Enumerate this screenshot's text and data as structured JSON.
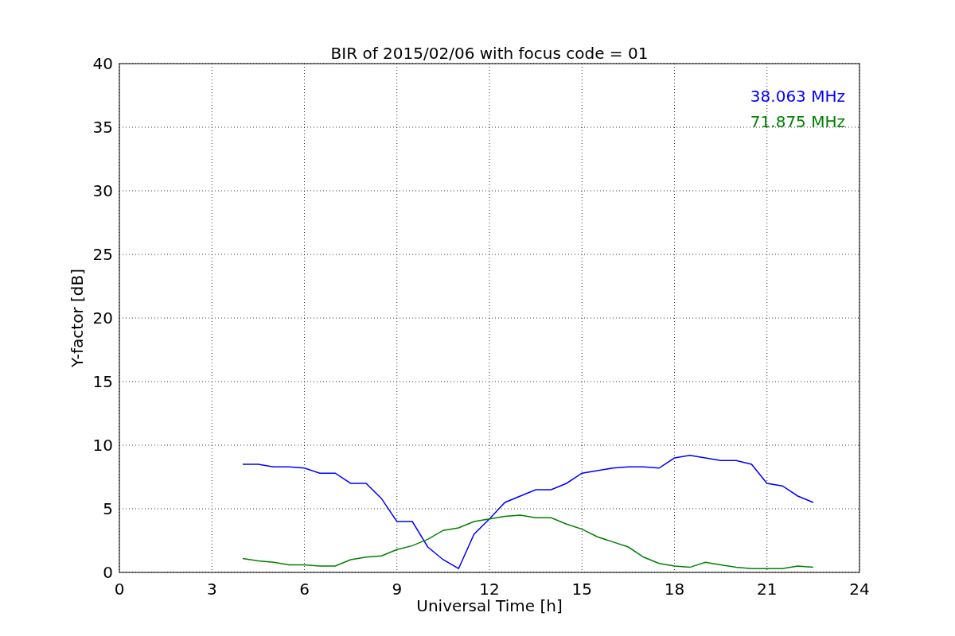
{
  "chart_data": {
    "type": "line",
    "title": "BIR of 2015/02/06 with focus code = 01",
    "xlabel": "Universal Time [h]",
    "ylabel": "Y-factor [dB]",
    "x": [
      4,
      4.5,
      5,
      5.5,
      6,
      6.5,
      7,
      7.5,
      8,
      8.5,
      9,
      9.5,
      10,
      10.5,
      11,
      11.5,
      12,
      12.5,
      13,
      13.5,
      14,
      14.5,
      15,
      15.5,
      16,
      16.5,
      17,
      17.5,
      18,
      18.5,
      19,
      19.5,
      20,
      20.5,
      21,
      21.5,
      22,
      22.5
    ],
    "series": [
      {
        "name": "38.063 MHz",
        "color": "#0000ff",
        "values": [
          8.5,
          8.5,
          8.3,
          8.3,
          8.2,
          7.8,
          7.8,
          7,
          7,
          5.8,
          4,
          4,
          2,
          1,
          0.3,
          3,
          4.2,
          5.5,
          6,
          6.5,
          6.5,
          7,
          7.8,
          8,
          8.2,
          8.3,
          8.3,
          8.2,
          9,
          9.2,
          9,
          8.8,
          8.8,
          8.5,
          7,
          6.8,
          6,
          5.5
        ]
      },
      {
        "name": "71.875 MHz",
        "color": "#008000",
        "values": [
          1.1,
          0.9,
          0.8,
          0.6,
          0.6,
          0.5,
          0.5,
          1,
          1.2,
          1.3,
          1.8,
          2.1,
          2.6,
          3.3,
          3.5,
          4,
          4.2,
          4.4,
          4.5,
          4.3,
          4.3,
          3.8,
          3.4,
          2.8,
          2.4,
          2,
          1.2,
          0.7,
          0.5,
          0.4,
          0.8,
          0.6,
          0.4,
          0.3,
          0.3,
          0.3,
          0.5,
          0.4
        ]
      }
    ],
    "xlim": [
      0,
      24
    ],
    "ylim": [
      0,
      40
    ],
    "xticks": [
      0,
      3,
      6,
      9,
      12,
      15,
      18,
      21,
      24
    ],
    "yticks": [
      0,
      5,
      10,
      15,
      20,
      25,
      30,
      35,
      40
    ],
    "grid": true
  }
}
